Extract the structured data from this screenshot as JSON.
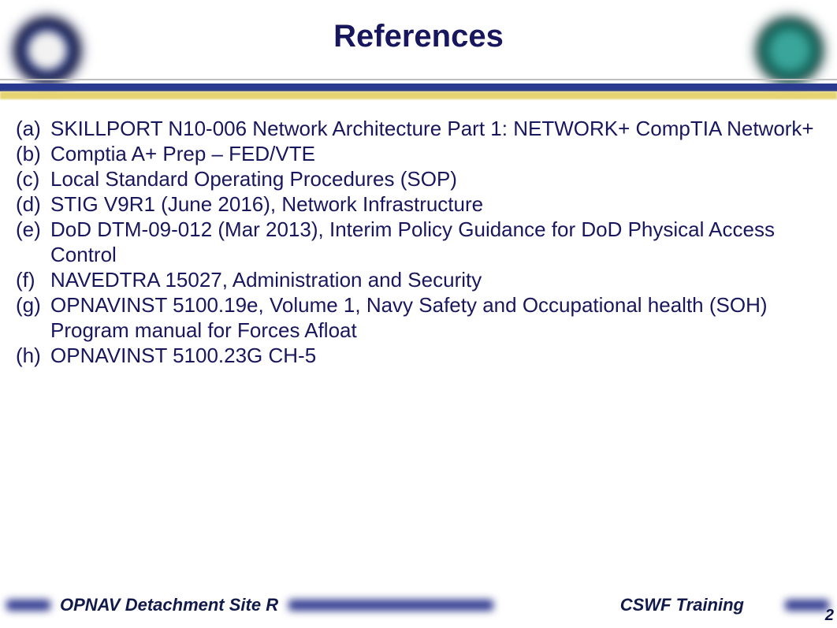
{
  "title": "References",
  "references": [
    {
      "label": "(a)",
      "text": "SKILLPORT N10-006 Network Architecture Part 1: NETWORK+ CompTIA Network+"
    },
    {
      "label": "(b)",
      "text": "Comptia A+ Prep – FED/VTE"
    },
    {
      "label": "(c)",
      "text": "Local Standard Operating Procedures (SOP)"
    },
    {
      "label": "(d)",
      "text": "STIG V9R1 (June 2016), Network Infrastructure"
    },
    {
      "label": "(e)",
      "text": "DoD DTM-09-012 (Mar 2013), Interim Policy Guidance for DoD Physical Access Control"
    },
    {
      "label": "(f)",
      "text": "NAVEDTRA 15027, Administration and Security"
    },
    {
      "label": "(g)",
      "text": "OPNAVINST 5100.19e, Volume 1, Navy Safety and Occupational health (SOH) Program manual for Forces Afloat"
    },
    {
      "label": "(h)",
      "text": "OPNAVINST 5100.23G CH-5"
    }
  ],
  "footer": {
    "left": "OPNAV Detachment Site R",
    "right": "CSWF Training"
  },
  "page_number": "2",
  "logos": {
    "left": "navy-seal-icon",
    "right": "command-seal-icon"
  },
  "colors": {
    "brand_navy": "#18175e",
    "band_blue": "#2a3a8e",
    "band_gold": "#e4cf63"
  }
}
